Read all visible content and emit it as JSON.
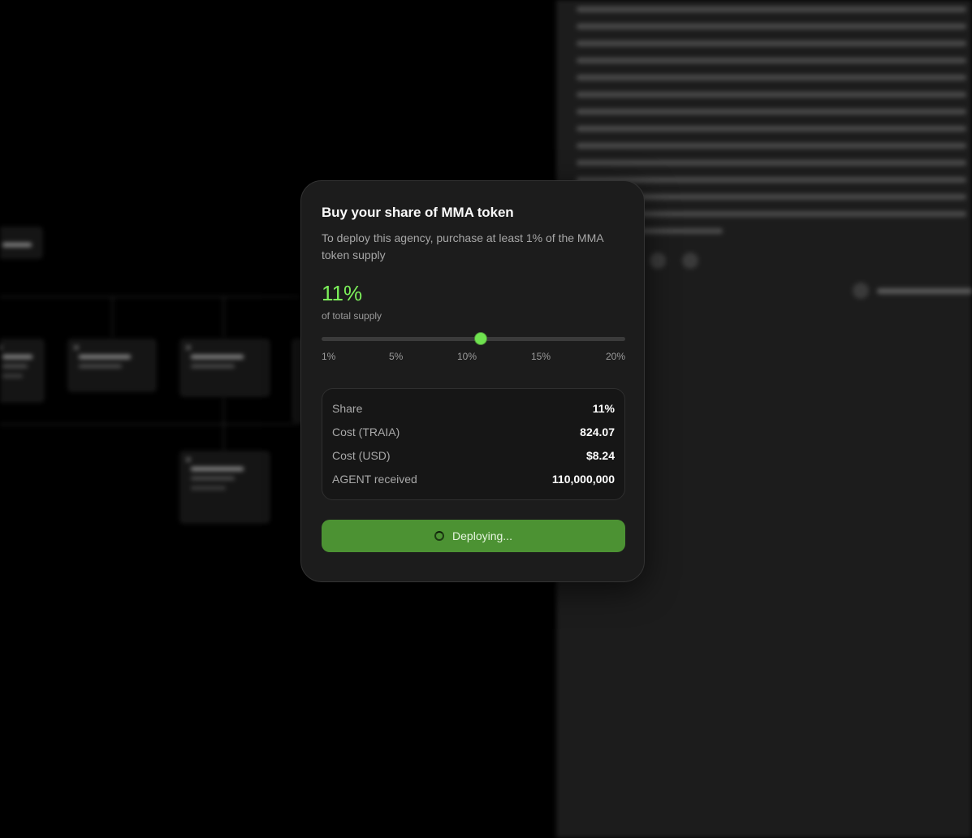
{
  "modal": {
    "title": "Buy your share of MMA token",
    "subtitle": "To deploy this agency, purchase at least 1% of the MMA token supply",
    "selected_percent": "11%",
    "supply_caption": "of total supply",
    "slider": {
      "value_percent": 11,
      "min_percent": 1,
      "max_percent": 20
    },
    "ticks": [
      "1%",
      "5%",
      "10%",
      "15%",
      "20%"
    ],
    "summary": [
      {
        "label": "Share",
        "value": "11%"
      },
      {
        "label": "Cost (TRAIA)",
        "value": "824.07"
      },
      {
        "label": "Cost (USD)",
        "value": "$8.24"
      },
      {
        "label": "AGENT received",
        "value": "110,000,000"
      }
    ],
    "deploy_label": "Deploying...",
    "accent_color": "#7cf05a",
    "button_color": "#4c9233"
  },
  "icons": {
    "spinner": "loading-spinner-icon"
  }
}
